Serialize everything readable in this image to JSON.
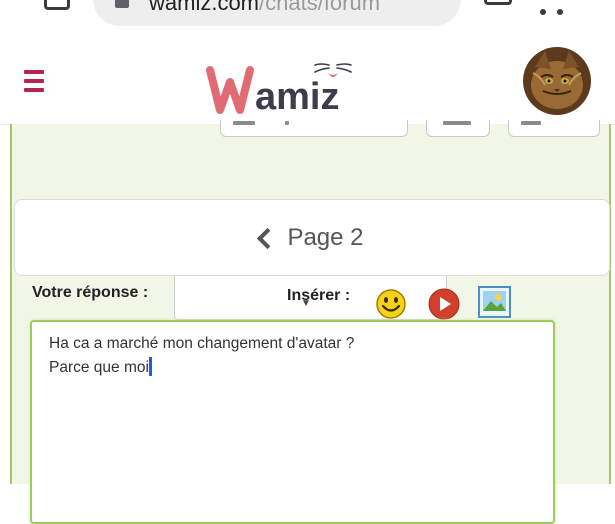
{
  "browser": {
    "url_host": "wamiz.com",
    "url_path": "/chats/forum"
  },
  "header": {
    "logo_text": "Wamiz",
    "colors": {
      "brand_red": "#e06b72",
      "brand_dark": "#3c3c4c",
      "hamburger": "#b5254e"
    }
  },
  "pagination": {
    "page_label": "Page 2"
  },
  "reply": {
    "label": "Votre réponse :",
    "insert_label": "Insérer :",
    "icons": [
      "smiley-icon",
      "video-icon",
      "image-icon"
    ],
    "editor_lines": [
      "Ha ca a marché mon changement d'avatar ?",
      "Parce que moi"
    ]
  }
}
